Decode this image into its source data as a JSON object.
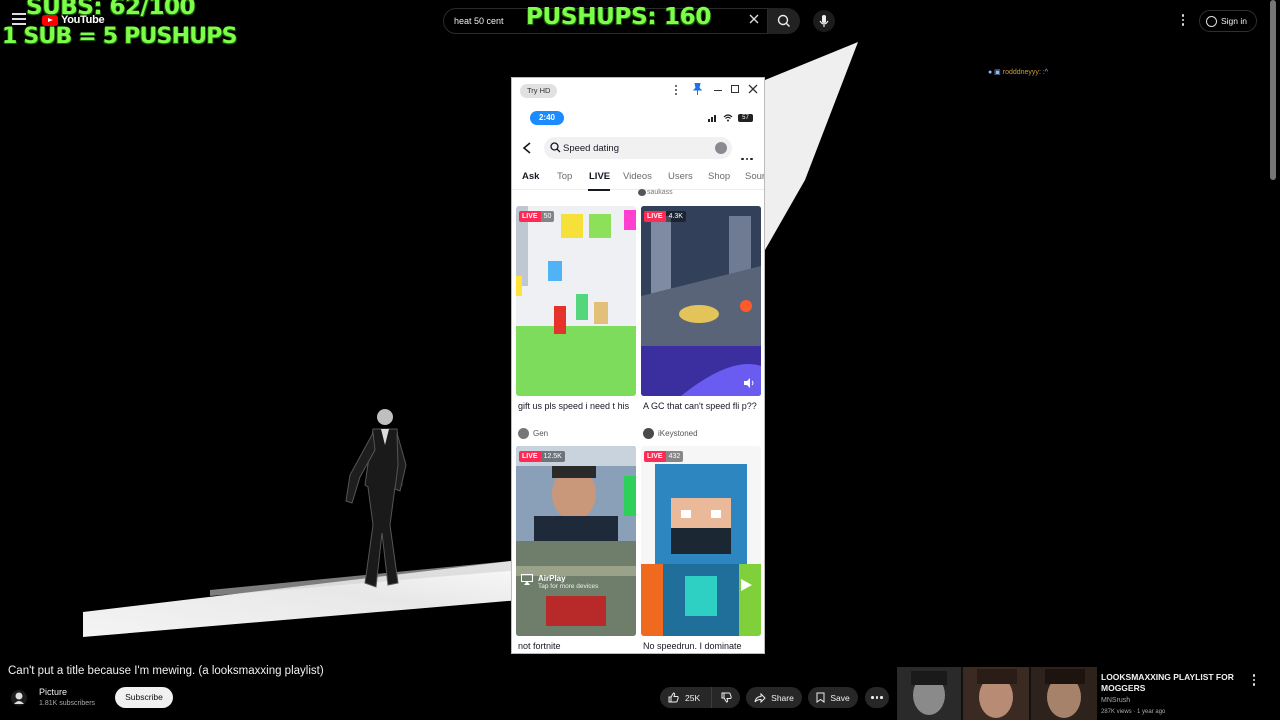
{
  "overlay": {
    "subs_counter": "SUBS: 62/100",
    "sub_rule": "1 SUB = 5 PUSHUPS",
    "pushups_counter": "PUSHUPS: 160"
  },
  "youtube_header": {
    "logo_text": "YouTube",
    "search_value": "heat 50 cent",
    "sign_in_label": "Sign in"
  },
  "chat": {
    "username": "rodddneyyy",
    "message": ":^"
  },
  "phone_window": {
    "try_hd_label": "Try HD",
    "status_time": "2:40",
    "battery": "57",
    "search_query": "Speed dating",
    "tabs": [
      "Ask",
      "Top",
      "LIVE",
      "Videos",
      "Users",
      "Shop",
      "Sour"
    ],
    "active_tab": "LIVE",
    "cut_off_username": "saukass",
    "cards": [
      {
        "live_label": "LIVE",
        "likes": "50",
        "title": "gift us pls speed i need t his",
        "user": "Gen"
      },
      {
        "live_label": "LIVE",
        "likes": "4.3K",
        "title": "A GC that can't speed fli p??",
        "user": "iKeystoned"
      },
      {
        "live_label": "LIVE",
        "likes": "12.5K",
        "title": "not fortnite",
        "user": ""
      },
      {
        "live_label": "LIVE",
        "likes": "432",
        "title": "No speedrun. I dominate",
        "user": ""
      }
    ],
    "airplay": {
      "title": "AirPlay",
      "subtitle": "Tap for more devices"
    }
  },
  "video_info": {
    "title": "Can't put a title because I'm mewing. (a looksmaxxing playlist)",
    "channel_name": "Picture",
    "subscribers": "1.81K subscribers",
    "subscribe_label": "Subscribe",
    "likes": "25K",
    "share_label": "Share",
    "save_label": "Save"
  },
  "next_video": {
    "title": "LOOKSMAXXING PLAYLIST FOR MOGGERS",
    "channel": "MNSrush",
    "meta": "287K views · 1 year ago"
  },
  "colors": {
    "overlay_green": "#7dff4a",
    "youtube_red": "#ff0000",
    "tiktok_live": "#fe2c55",
    "status_blue": "#1a8cff"
  }
}
